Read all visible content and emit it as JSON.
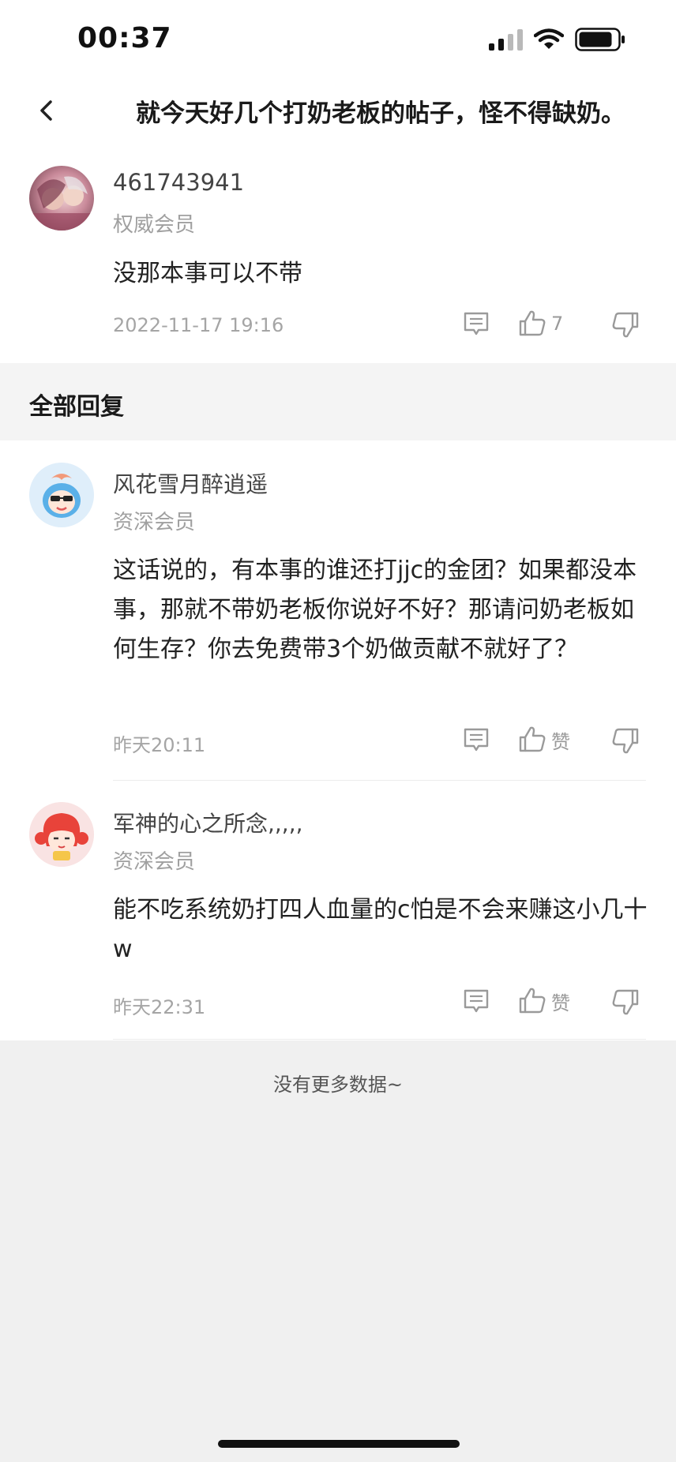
{
  "status_bar": {
    "time": "00:37"
  },
  "header": {
    "title": "就今天好几个打奶老板的帖子，怪不得缺奶。"
  },
  "main_comment": {
    "username": "461743941",
    "level": "权威会员",
    "content": "没那本事可以不带",
    "time": "2022-11-17 19:16",
    "like_count": "7"
  },
  "section": {
    "title": "全部回复"
  },
  "replies": [
    {
      "username": "风花雪月醉逍遥",
      "level": "资深会员",
      "content": "这话说的，有本事的谁还打jjc的金团？如果都没本事，那就不带奶老板你说好不好？那请问奶老板如何生存？你去免费带3个奶做贡献不就好了？",
      "time": "昨天20:11",
      "like_label": "赞"
    },
    {
      "username": "军神的心之所念,,,,,",
      "level": "资深会员",
      "content": "能不吃系统奶打四人血量的c怕是不会来赚这小几十w",
      "time": "昨天22:31",
      "like_label": "赞"
    }
  ],
  "footer": {
    "no_more": "没有更多数据~"
  },
  "icons": {
    "back": "chevron-left-icon",
    "comment": "comment-icon",
    "like": "thumbs-up-icon",
    "dislike": "thumbs-down-icon",
    "signal": "signal-icon",
    "wifi": "wifi-icon",
    "battery": "battery-icon"
  },
  "colors": {
    "background": "#f0f0f0",
    "card": "#ffffff",
    "muted_text": "#a5a5a5"
  }
}
